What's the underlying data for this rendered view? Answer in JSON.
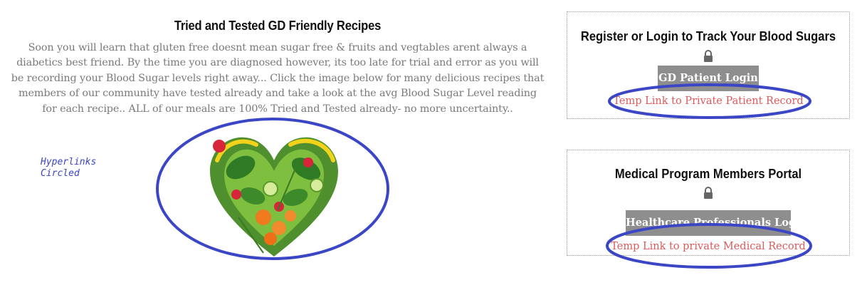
{
  "recipes": {
    "title": "Tried and Tested GD Friendly Recipes",
    "intro": "Soon you will learn that gluten free doesnt mean sugar free & fruits and vegtables arent always a diabetics best friend. By the time you are diagnosed however, its too late for trial and error as you will be recording your Blood Sugar levels right away... Click the image below for many delicious recipes that members of our community have tested already and take a look at the avg Blood Sugar Level reading for each recipe.. ALL of our meals are 100% Tried and Tested already- no more uncertainty..",
    "image_icon": "vegetable-heart-image"
  },
  "annotation": {
    "line1": "Hyperlinks",
    "line2": "Circled",
    "color": "#3b46c6"
  },
  "login_panel": {
    "title": "Register or Login to Track Your Blood Sugars",
    "lock_icon": "lock-icon",
    "button_label": "GD Patient Login",
    "temp_link": "Temp Link to Private Patient Record"
  },
  "medical_panel": {
    "title": "Medical Program Members Portal",
    "lock_icon": "lock-icon",
    "button_label": "Healthcare Professionals Login",
    "temp_link": "Temp Link to private Medical Record"
  },
  "colors": {
    "button_bg": "#8e8e8e",
    "link": "#e0595a",
    "body_text": "#7a7a7a",
    "highlight": "#3b46c6"
  }
}
